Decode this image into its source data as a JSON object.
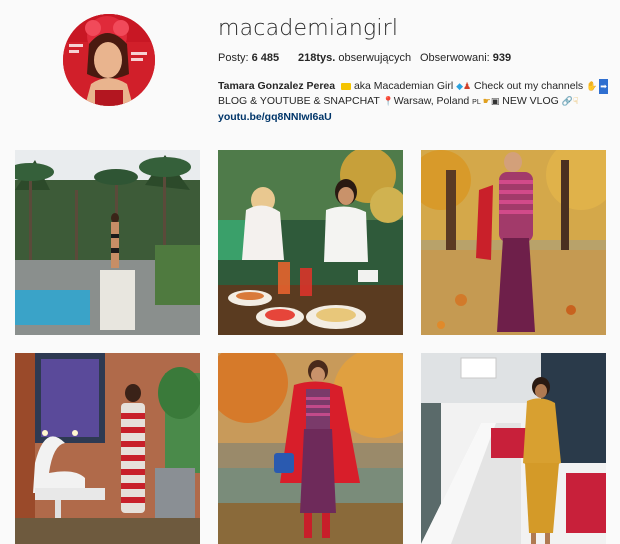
{
  "profile": {
    "username": "macademiangirl",
    "posts_label": "Posty: ",
    "posts_value": "6 485",
    "followers_value": "218tys.",
    "followers_label": " obserwujących",
    "following_label": "Obserwowani: ",
    "following_value": "939"
  },
  "bio": {
    "name": "Tamara Gonzalez Perea",
    "line1_a": " aka Macademian Girl ",
    "line1_b": " Check out my channels ",
    "line2_a": "BLOG & YOUTUBE & SNAPCHAT ",
    "line2_b": "Warsaw, Poland ",
    "line2_c": "PL",
    "line2_d": " NEW VLOG ",
    "link": "youtu.be/gq8NNIwI6aU"
  },
  "posts": [
    {
      "scene": "pool-palm-trees"
    },
    {
      "scene": "breakfast-friends"
    },
    {
      "scene": "autumn-park-pink-stripes"
    },
    {
      "scene": "swan-lamp-striped-dress"
    },
    {
      "scene": "red-coat-lake"
    },
    {
      "scene": "yellow-dress-terrace"
    }
  ],
  "colors": {
    "background": "#fafafa",
    "text": "#262626",
    "link": "#003569"
  }
}
